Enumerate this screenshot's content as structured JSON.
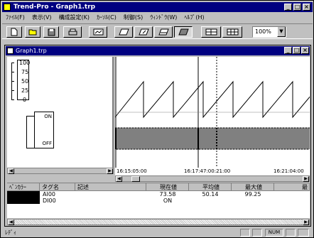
{
  "app": {
    "title": "Trend-Pro - Graph1.trp"
  },
  "menu": [
    "ﾌｧｲﾙ(F)",
    "表示(V)",
    "構成設定(K)",
    "ｶｰｿﾙ(C)",
    "制御(S)",
    "ｳｨﾝﾄﾞｳ(W)",
    "ﾍﾙﾌﾟ(H)"
  ],
  "toolbar": {
    "zoom_value": "100%"
  },
  "child": {
    "title": "Graph1.trp"
  },
  "scale": {
    "ticks": [
      "100",
      "75",
      "50",
      "25",
      "0"
    ]
  },
  "digital": {
    "on_label": "ON",
    "off_label": "OFF"
  },
  "timeline": {
    "labels": [
      "16:15:05:00",
      "16:17:47:00:21:00",
      "16:21:04:00"
    ]
  },
  "table": {
    "headers": [
      "ﾍﾟﾝｶﾗｰ",
      "タグ名",
      "記述",
      "現在値",
      "平均値",
      "最大値",
      "最"
    ],
    "rows": [
      {
        "pen_color": "#000000",
        "tag": "AI00",
        "desc": "",
        "current": "73.58",
        "average": "50.14",
        "max": "99.25"
      },
      {
        "pen_color": "#000000",
        "tag": "DI00",
        "desc": "",
        "current": "ON",
        "average": "",
        "max": ""
      }
    ]
  },
  "status": {
    "text": "ﾚﾃﾞｨ",
    "num": "NUM"
  }
}
